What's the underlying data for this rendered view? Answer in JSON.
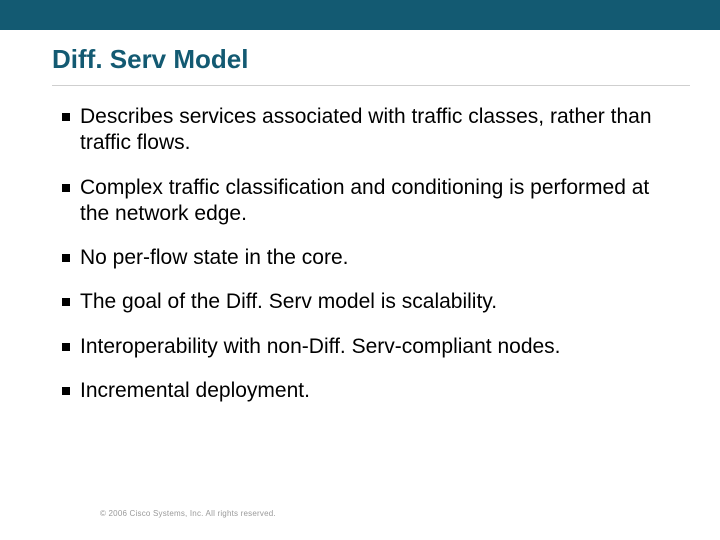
{
  "title": "Diff. Serv Model",
  "bullets": [
    "Describes services associated with traffic classes, rather than traffic flows.",
    "Complex traffic classification and conditioning is performed at the network edge.",
    "No per-flow state in the core.",
    "The goal of the Diff. Serv model is scalability.",
    "Interoperability with non-Diff. Serv-compliant nodes.",
    "Incremental deployment."
  ],
  "footer": "© 2006 Cisco Systems, Inc. All rights reserved."
}
